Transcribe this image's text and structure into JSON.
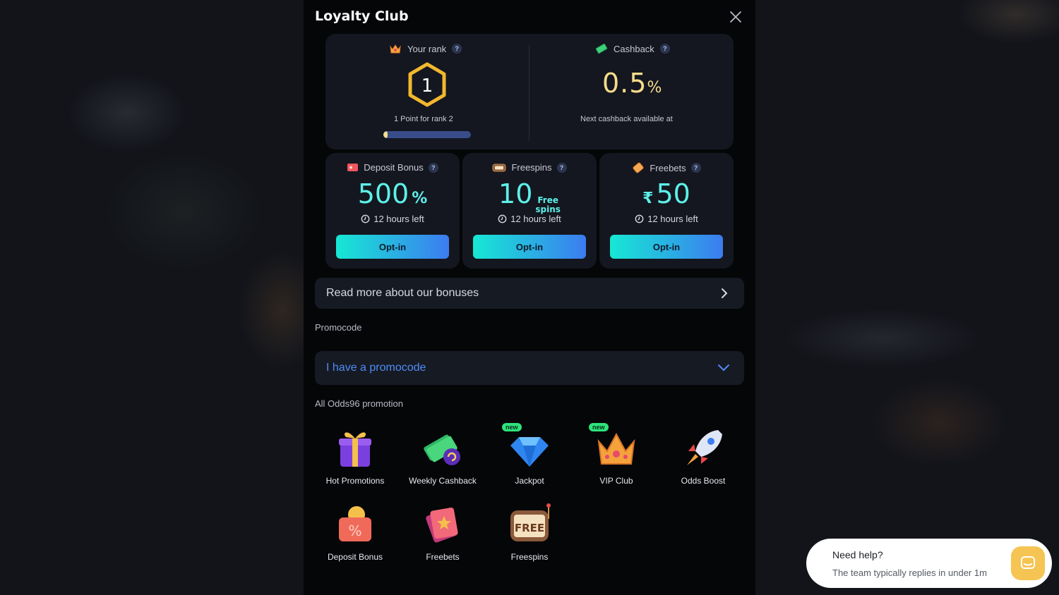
{
  "modal": {
    "title": "Loyalty Club"
  },
  "rank": {
    "header": "Your rank",
    "rank_value": "1",
    "points_text": "1 Point for rank 2",
    "progress": 0.05
  },
  "cashback": {
    "header": "Cashback",
    "value": "0.5",
    "unit": "%",
    "next_text": "Next cashback available at"
  },
  "bonuses": [
    {
      "title": "Deposit Bonus",
      "value": "500",
      "suffix": "%",
      "time_left": "12 hours left",
      "button": "Opt-in"
    },
    {
      "title": "Freespins",
      "value": "10",
      "suffix_line1": "Free",
      "suffix_line2": "spins",
      "time_left": "12 hours left",
      "button": "Opt-in"
    },
    {
      "title": "Freebets",
      "prefix": "₹",
      "value": "50",
      "time_left": "12 hours left",
      "button": "Opt-in"
    }
  ],
  "read_more": "Read more about our bonuses",
  "promocode": {
    "label": "Promocode",
    "dropdown": "I have a promocode"
  },
  "promotions": {
    "label": "All Odds96 promotion",
    "items": [
      {
        "label": "Hot Promotions",
        "icon": "gift-icon"
      },
      {
        "label": "Weekly Cashback",
        "icon": "cash-icon"
      },
      {
        "label": "Jackpot",
        "icon": "diamond-icon",
        "badge": "new"
      },
      {
        "label": "VIP Club",
        "icon": "crown-icon",
        "badge": "new"
      },
      {
        "label": "Odds Boost",
        "icon": "rocket-icon"
      },
      {
        "label": "Deposit Bonus",
        "icon": "wallet-icon"
      },
      {
        "label": "Freebets",
        "icon": "ticket-icon"
      },
      {
        "label": "Freespins",
        "icon": "slot-icon"
      }
    ]
  },
  "help": {
    "title": "Need help?",
    "subtitle": "The team typically replies in under 1m"
  },
  "colors": {
    "accent_cyan": "#5ef0ea",
    "gold": "#f6dd8a",
    "link_blue": "#4f8cf5",
    "new_badge": "#2ee37b"
  }
}
